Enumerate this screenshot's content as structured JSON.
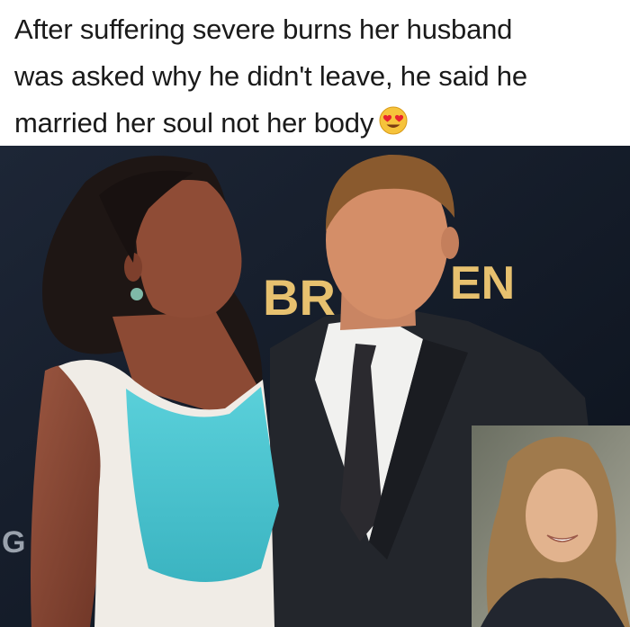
{
  "caption": {
    "line1": "After suffering severe burns her husband",
    "line2": "was asked why he didn't leave, he said he",
    "line3": "married her soul not her body",
    "emoji_icon": "heart-eyes-emoji-icon"
  },
  "photo": {
    "backdrop_text_left": "BR",
    "backdrop_text_right": "EN",
    "backdrop_text_edge": "G"
  },
  "colors": {
    "caption_text": "#1a1a1a",
    "backdrop": "#141c2b",
    "dress_blue": "#48c2cf",
    "suit": "#23262c"
  }
}
